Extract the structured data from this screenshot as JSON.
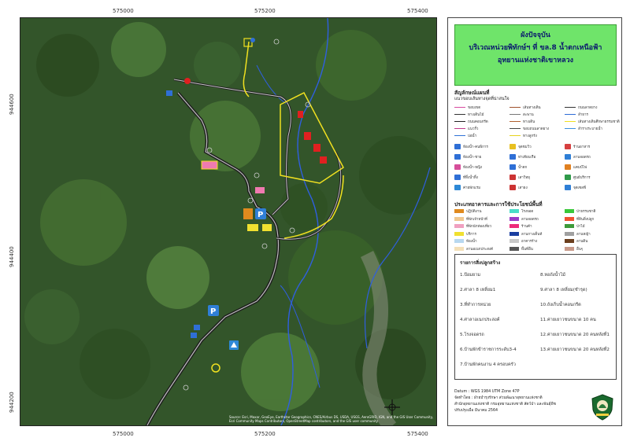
{
  "grid": {
    "x_ticks": [
      "575000",
      "575200",
      "575400"
    ],
    "y_ticks": [
      "944600",
      "944400",
      "944200"
    ]
  },
  "map": {
    "credit": "Source: Esri, Maxar, GeoEye, Earthstar Geographics, CNES/Airbus DS, USDA, USGS, AeroGRID, IGN, and the GIS User Community, Esri Community Maps Contributors, OpenStreetMap contributors, and the GIS user community"
  },
  "title": {
    "line1": "ผังปัจจุบัน",
    "line2": "บริเวณหน่วยพิทักษ์ฯ ที่ ขล.8 น้ำตกเหนือฟ้า",
    "line3": "อุทยานแห่งชาติเขาหลวง"
  },
  "legend": {
    "heading": "สัญลักษณ์แผนที่",
    "subheading": "แนวขอบเส้นทางจุดที่น่าสนใจ",
    "lines": [
      {
        "label": "ขอบเขต",
        "color": "#d84aa0"
      },
      {
        "label": "ทางเดินไม้",
        "color": "#333333"
      },
      {
        "label": "ถนนคอนกรีต",
        "color": "#222222"
      },
      {
        "label": "แนวรั้ว",
        "color": "#c0398a"
      },
      {
        "label": "บ่อน้ำ",
        "color": "#2f72d6"
      },
      {
        "label": "เส้นทางเดิน",
        "color": "#a0522d"
      },
      {
        "label": "สะพาน",
        "color": "#777777"
      },
      {
        "label": "ทางเดิน",
        "color": "#b06030"
      },
      {
        "label": "ขอบถนนลาดยาง",
        "color": "#444444"
      },
      {
        "label": "ทางลูกรัง",
        "color": "#e6d21e"
      },
      {
        "label": "ถนนลาดยาง",
        "color": "#333333"
      },
      {
        "label": "ลำธาร",
        "color": "#2d6bd6"
      },
      {
        "label": "เส้นทางเดินศึกษาธรรมชาติ",
        "color": "#f0e020"
      },
      {
        "label": "ลำรางระบายน้ำ",
        "color": "#3a8ee0"
      }
    ],
    "icons": [
      {
        "label": "ห้องน้ำ-คนพิการ",
        "color": "#2f6fd6"
      },
      {
        "label": "ห้องน้ำ-ชาย",
        "color": "#2f6fd6"
      },
      {
        "label": "ห้องน้ำ-หญิง",
        "color": "#d64e9a"
      },
      {
        "label": "ที่ทิ้งน้ำทิ้ง",
        "color": "#2f6fd6"
      },
      {
        "label": "ค่ายพักแรม",
        "color": "#2d88d6"
      },
      {
        "label": "จุดชมวิว",
        "color": "#e8c020"
      },
      {
        "label": "ท่าเทียบเรือ",
        "color": "#2f6fd6"
      },
      {
        "label": "น้ำตก",
        "color": "#2f6fd6"
      },
      {
        "label": "เสาวิทยุ",
        "color": "#cc3333"
      },
      {
        "label": "เสาธง",
        "color": "#cc3333"
      },
      {
        "label": "ร้านอาหาร",
        "color": "#d64040"
      },
      {
        "label": "ลานจอดรถ",
        "color": "#2f7fd6"
      },
      {
        "label": "แคมป์ไฟ",
        "color": "#e08020"
      },
      {
        "label": "ศูนย์บริการ",
        "color": "#2f9a4a"
      },
      {
        "label": "จุดเซลฟี่",
        "color": "#2f7fd6"
      }
    ],
    "landuse_heading": "ประเภทอาคารและการใช้ประโยชน์พื้นที่",
    "landuse": [
      {
        "label": "ปฏิบัติงาน",
        "color": "#e08a1e"
      },
      {
        "label": "ที่พักเจ้าหน้าที่",
        "color": "#f0c890"
      },
      {
        "label": "ที่พักนักท่องเที่ยว",
        "color": "#f0a0c0"
      },
      {
        "label": "บริการ",
        "color": "#f0e030"
      },
      {
        "label": "ห้องน้ำ",
        "color": "#b8d8f0"
      },
      {
        "label": "ลานอเนกประสงค์",
        "color": "#f4e0b8"
      },
      {
        "label": "โรงจอด",
        "color": "#4adcc8"
      },
      {
        "label": "ลานจอดรถ",
        "color": "#9a3ac8"
      },
      {
        "label": "ร้านค้า",
        "color": "#ee2a7a"
      },
      {
        "label": "ลานกางเต็นท์",
        "color": "#1a3ea0"
      },
      {
        "label": "อาคารร้าง",
        "color": "#c8c8c8"
      },
      {
        "label": "พื้นที่อื่น",
        "color": "#555555"
      },
      {
        "label": "ป่าธรรมชาติ",
        "color": "#3ac83a"
      },
      {
        "label": "ที่ดินสิ่งปลูก",
        "color": "#f05030"
      },
      {
        "label": "ป่าไม้",
        "color": "#3e9a3a"
      },
      {
        "label": "ลานหญ้า",
        "color": "#a0a0a0"
      },
      {
        "label": "ลานดิน",
        "color": "#6b3f1e"
      },
      {
        "label": "อื่นๆ",
        "color": "#c89a8a"
      }
    ]
  },
  "buildings": {
    "heading": "รายการสิ่งปลูกสร้าง",
    "col1": [
      "1.ป้อมยาม",
      "2.ศาลา 8 เหลี่ยม1",
      "3.ที่ทำการหน่วย",
      "4.ศาลาอเนกประสงค์",
      "5.โรงจอดรถ",
      "6.บ้านพักข้าราชการระดับ3-4",
      "7.บ้านพักคนงาน 4 ครอบครัว"
    ],
    "col2": [
      "8.หอถังน้ำไม้",
      "9.ศาลา 8 เหลี่ยม(ชำรุด)",
      "10.ถังเก็บน้ำคอนกรีต",
      "11.ค่ายเยาวชนขนาด 10 คน",
      "12.ค่ายเยาวชนขนาด 20 คนหลังที่1",
      "13.ค่ายเยาวชนขนาด 20 คนหลังที่2"
    ]
  },
  "footer": {
    "datum": "Datum : WGS 1984 UTM Zone 47P",
    "prepared_by": "จัดทำโดย : ฝ่ายบำรุงรักษา ส่วนพัฒนาอุทยานแห่งชาติ",
    "office": "สำนักอุทยานแห่งชาติ กรมอุทยานแห่งชาติ สัตว์ป่า และพันธุ์พืช",
    "updated": "ปรับปรุงเมื่อ มีนาคม 2564"
  }
}
